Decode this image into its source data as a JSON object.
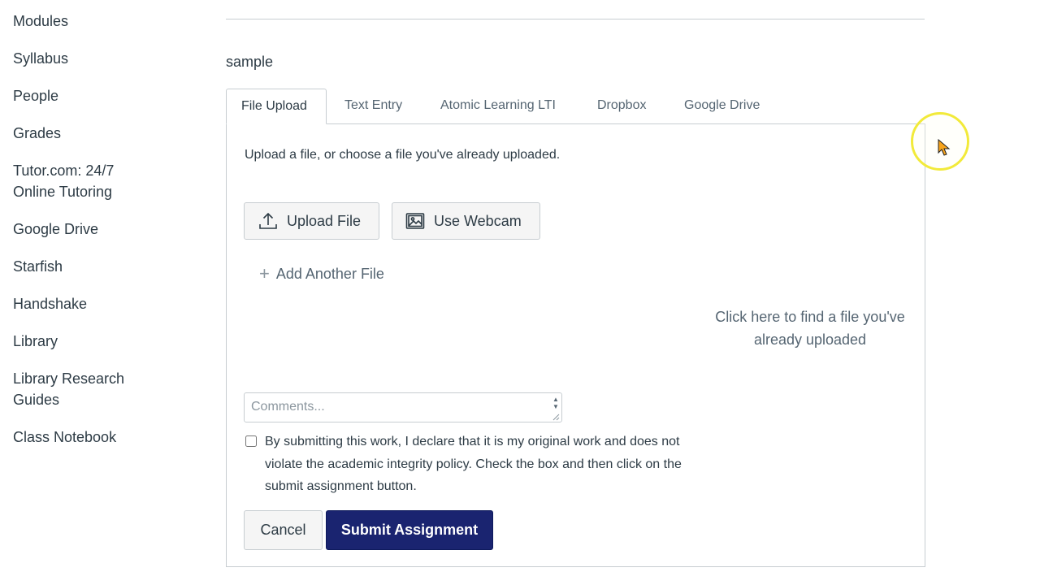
{
  "sidebar": {
    "items": [
      {
        "label": "Modules"
      },
      {
        "label": "Syllabus"
      },
      {
        "label": "People"
      },
      {
        "label": "Grades"
      },
      {
        "label": "Tutor.com: 24/7 Online Tutoring",
        "line1": "Tutor.com: 24/7",
        "line2": "Online Tutoring"
      },
      {
        "label": "Google Drive"
      },
      {
        "label": "Starfish"
      },
      {
        "label": "Handshake"
      },
      {
        "label": "Library"
      },
      {
        "label": "Library Research Guides",
        "line1": "Library Research",
        "line2": "Guides"
      },
      {
        "label": "Class Notebook"
      }
    ]
  },
  "assignment": {
    "title": "sample"
  },
  "tabs": [
    {
      "label": "File Upload",
      "active": true
    },
    {
      "label": "Text Entry"
    },
    {
      "label": "Atomic Learning LTI"
    },
    {
      "label": "Dropbox"
    },
    {
      "label": "Google Drive"
    }
  ],
  "upload": {
    "instructions": "Upload a file, or choose a file you've already uploaded.",
    "upload_button": "Upload File",
    "webcam_button": "Use Webcam",
    "add_another": "Add Another File",
    "find_file": "Click here to find a file you've already uploaded"
  },
  "comments": {
    "placeholder": "Comments...",
    "value": ""
  },
  "declaration": {
    "checked": false,
    "text": "By submitting this work, I declare that it is my original work and does not violate the academic integrity policy. Check the box and then click on the submit assignment button."
  },
  "actions": {
    "cancel": "Cancel",
    "submit": "Submit Assignment"
  },
  "colors": {
    "submit_bg": "#1a2470",
    "text": "#2d3b45",
    "border": "#c7cdd1",
    "cursor_ring": "#f2ea3a"
  }
}
